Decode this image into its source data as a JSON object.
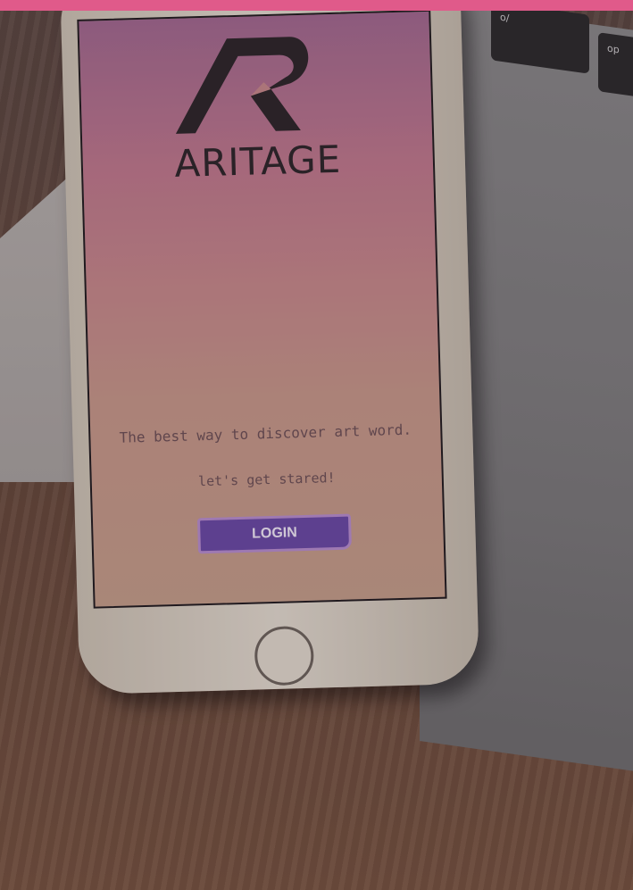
{
  "brand": {
    "name": "ARITAGE"
  },
  "screen": {
    "tagline": "The best way to discover art word.",
    "cta_text": "let's get stared!",
    "login_label": "LOGIN"
  },
  "keyboard": {
    "keys": [
      "o/",
      "op"
    ]
  },
  "colors": {
    "top_bar": "#e05a8a",
    "login_button": "#6a4aa6",
    "logo": "#2b2528"
  },
  "icons": {
    "logo": "aritage-r-logo",
    "home": "home-button-icon"
  }
}
